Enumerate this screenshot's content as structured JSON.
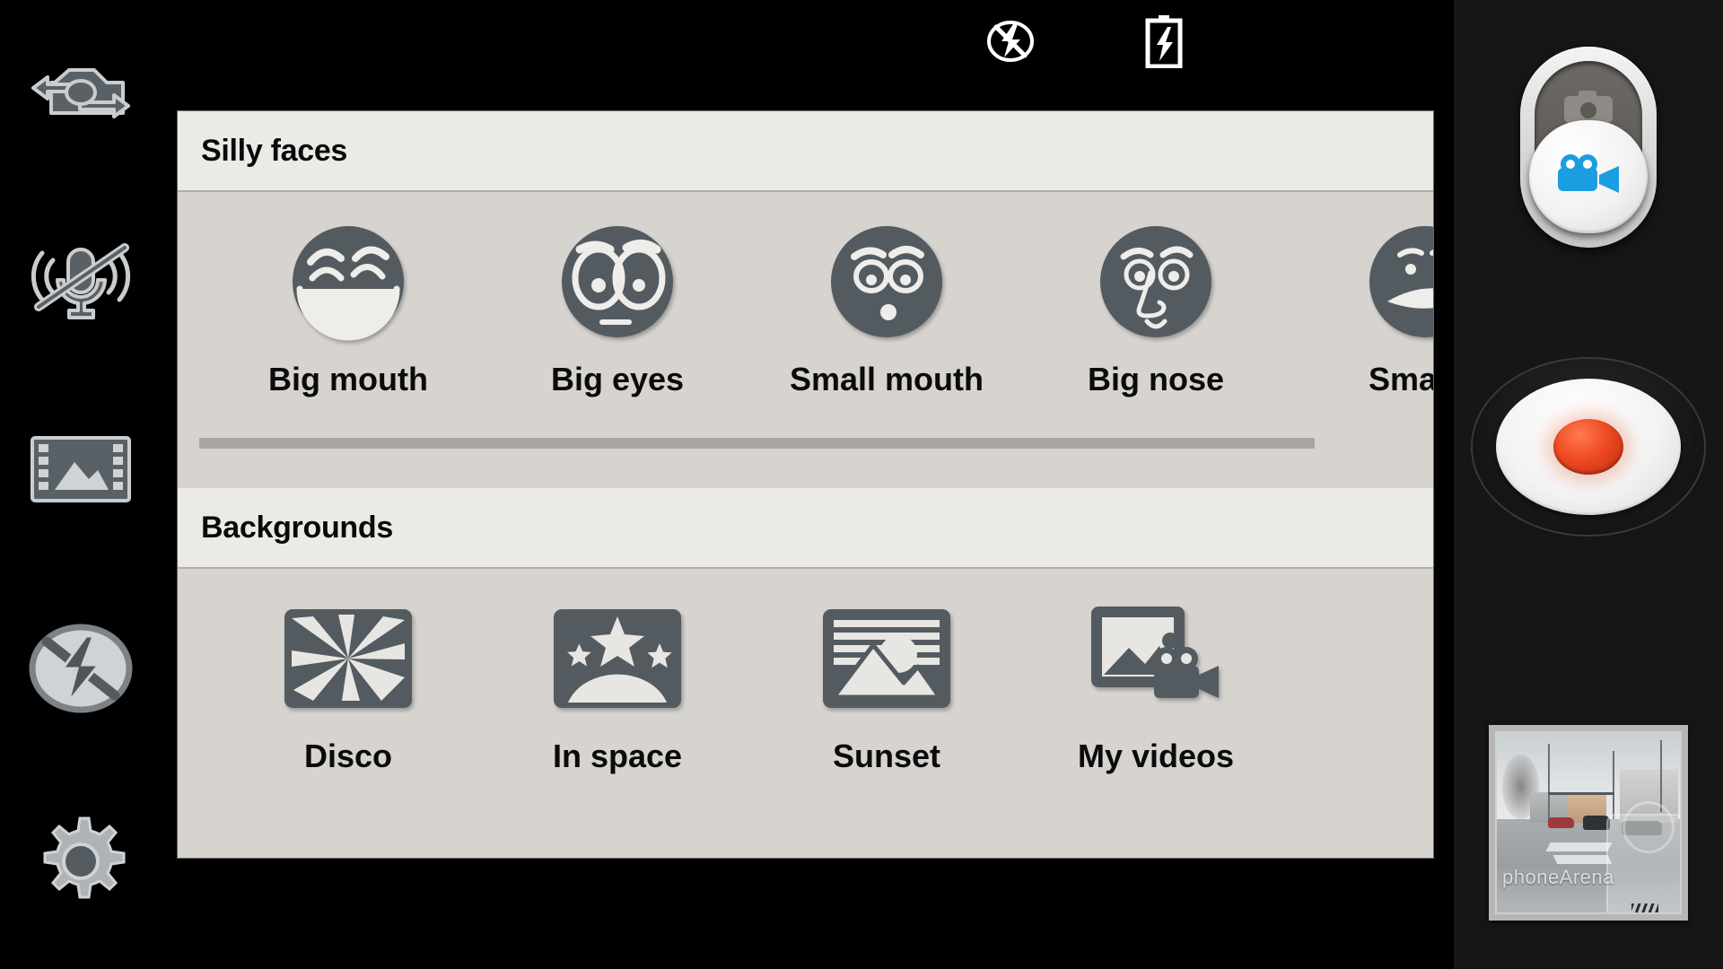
{
  "status_bar": {
    "icons": [
      {
        "name": "flash-off-icon",
        "label": "Flash off"
      },
      {
        "name": "battery-charging-icon",
        "label": "Battery charging"
      }
    ]
  },
  "left_rail": {
    "items": [
      {
        "name": "switch-camera-icon",
        "label": "Switch camera"
      },
      {
        "name": "microphone-off-icon",
        "label": "Microphone off"
      },
      {
        "name": "video-quality-icon",
        "label": "Video / gallery"
      },
      {
        "name": "flash-off-icon",
        "label": "Flash off"
      },
      {
        "name": "settings-gear-icon",
        "label": "Settings"
      }
    ]
  },
  "effect_panel": {
    "sections": [
      {
        "id": "silly-faces",
        "title": "Silly faces",
        "scrollable": true,
        "scroll_thumb_percent": 92,
        "items": [
          {
            "label": "Big mouth",
            "icon": "face-big-mouth-icon"
          },
          {
            "label": "Big eyes",
            "icon": "face-big-eyes-icon"
          },
          {
            "label": "Small mouth",
            "icon": "face-small-mouth-icon"
          },
          {
            "label": "Big nose",
            "icon": "face-big-nose-icon"
          },
          {
            "label": "Small e",
            "icon": "face-small-eyes-icon"
          }
        ]
      },
      {
        "id": "backgrounds",
        "title": "Backgrounds",
        "scrollable": false,
        "items": [
          {
            "label": "Disco",
            "icon": "background-disco-icon"
          },
          {
            "label": "In space",
            "icon": "background-in-space-icon"
          },
          {
            "label": "Sunset",
            "icon": "background-sunset-icon"
          },
          {
            "label": "My videos",
            "icon": "background-my-videos-icon"
          }
        ]
      }
    ]
  },
  "right_rail": {
    "mode_toggle": {
      "name": "camera-video-mode-toggle",
      "top_icon": "still-camera-icon",
      "knob_icon": "video-camera-icon",
      "selected_mode": "video",
      "accent_color": "#1b9ee0"
    },
    "record_button": {
      "name": "record-button",
      "label": "Record",
      "dot_color": "#ef4a22"
    },
    "thumbnail": {
      "name": "last-capture-thumbnail",
      "watermark": "phoneArena"
    }
  },
  "colors": {
    "panel_bg": "#d7d4d0",
    "header_bg": "#eceae6",
    "icon_gray": "#545b60",
    "viewfinder_bg": "#000000",
    "rail_bg": "#161616",
    "accent_blue": "#1b9ee0",
    "record_red": "#ef4a22"
  }
}
